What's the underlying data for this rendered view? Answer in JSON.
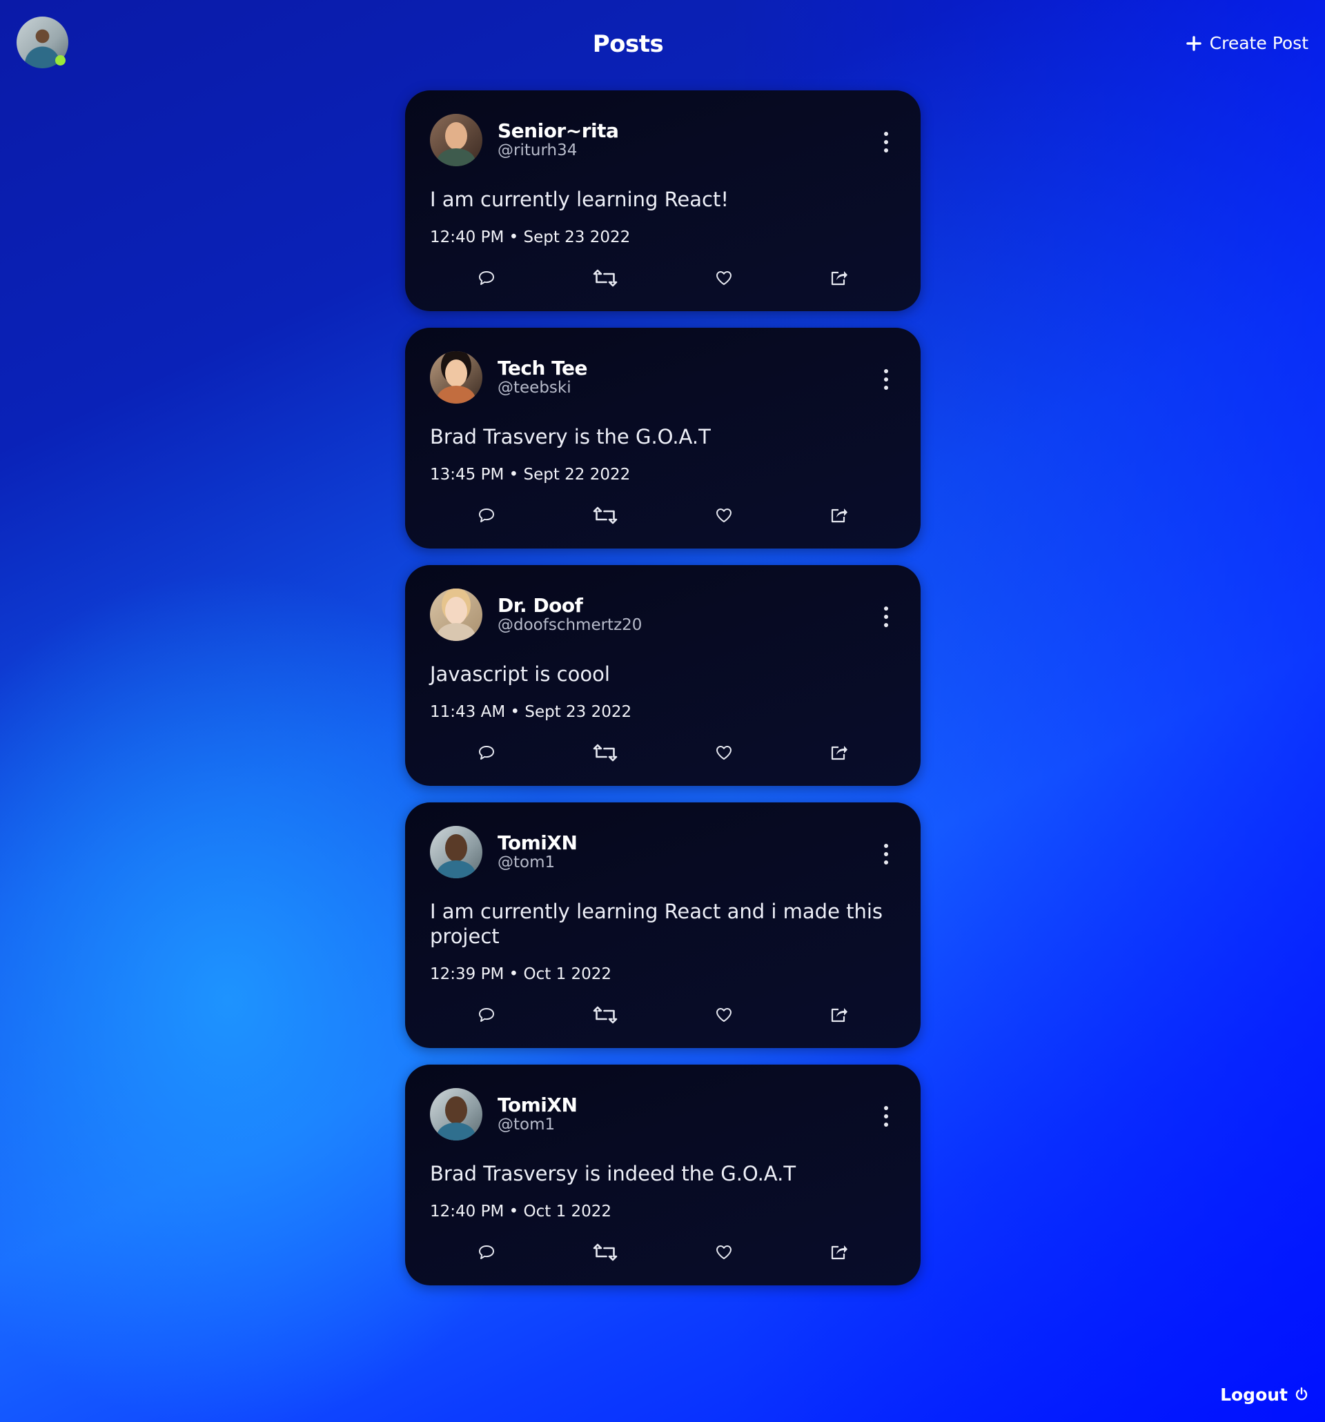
{
  "header": {
    "title": "Posts",
    "create_post_label": "Create Post",
    "online_status_color": "#9be83a"
  },
  "posts": [
    {
      "display_name": "Senior~rita",
      "handle": "@riturh34",
      "text": "I am currently learning React!",
      "timestamp": "12:40 PM • Sept 23 2022"
    },
    {
      "display_name": "Tech Tee",
      "handle": "@teebski",
      "text": "Brad Trasvery is the G.O.A.T",
      "timestamp": "13:45 PM • Sept 22 2022"
    },
    {
      "display_name": "Dr. Doof",
      "handle": "@doofschmertz20",
      "text": "Javascript is coool",
      "timestamp": "11:43 AM • Sept 23 2022"
    },
    {
      "display_name": "TomiXN",
      "handle": "@tom1",
      "text": "I am currently learning React and i made this project",
      "timestamp": "12:39 PM • Oct 1 2022"
    },
    {
      "display_name": "TomiXN",
      "handle": "@tom1",
      "text": "Brad Trasversy is indeed the G.O.A.T",
      "timestamp": "12:40 PM • Oct 1 2022"
    }
  ],
  "footer": {
    "logout_label": "Logout"
  },
  "icons": {
    "comment": "comment-icon",
    "retweet": "retweet-icon",
    "like": "heart-icon",
    "share": "share-icon",
    "more": "more-vertical-icon",
    "create": "plus-icon",
    "logout": "power-icon"
  }
}
